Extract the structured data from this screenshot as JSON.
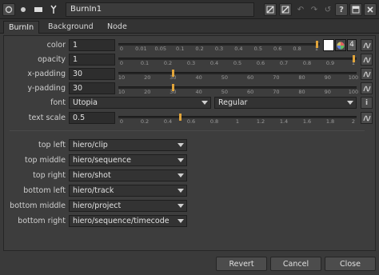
{
  "titlebar": {
    "node_name": "BurnIn1",
    "help_label": "?",
    "icons": [
      "node-settings-icon",
      "pin-icon",
      "tools-icon",
      "rect-a-icon",
      "rect-b-icon",
      "undo-icon",
      "redo-icon",
      "revert-icon",
      "help-icon",
      "float-icon",
      "close-icon"
    ]
  },
  "tabs": [
    "BurnIn",
    "Background",
    "Node"
  ],
  "active_tab": "BurnIn",
  "params": {
    "color": {
      "label": "color",
      "value": "1",
      "channels": "4",
      "ticks": [
        "0",
        "0.01",
        "0.05",
        "0.1",
        "0.2",
        "0.3",
        "0.4",
        "0.5",
        "0.6",
        "0.8",
        "1"
      ],
      "level": 1.0
    },
    "opacity": {
      "label": "opacity",
      "value": "1",
      "ticks": [
        "0",
        "0.1",
        "0.2",
        "0.3",
        "0.4",
        "0.5",
        "0.6",
        "0.7",
        "0.8",
        "0.9",
        "1"
      ],
      "level": 1.0
    },
    "x_padding": {
      "label": "x-padding",
      "value": "30",
      "ticks": [
        "10",
        "20",
        "30",
        "40",
        "50",
        "60",
        "70",
        "80",
        "90",
        "100"
      ],
      "level": 30
    },
    "y_padding": {
      "label": "y-padding",
      "value": "30",
      "ticks": [
        "10",
        "20",
        "30",
        "40",
        "50",
        "60",
        "70",
        "80",
        "90",
        "100"
      ],
      "level": 30
    },
    "font": {
      "label": "font",
      "family": "Utopia",
      "style": "Regular",
      "info": "i"
    },
    "text_scale": {
      "label": "text scale",
      "value": "0.5",
      "ticks": [
        "0",
        "0.2",
        "0.4",
        "0.6",
        "0.8",
        "1",
        "1.2",
        "1.4",
        "1.6",
        "1.8",
        "2"
      ],
      "level": 0.5
    }
  },
  "burnins": [
    {
      "label": "top left",
      "value": "hiero/clip"
    },
    {
      "label": "top middle",
      "value": "hiero/sequence"
    },
    {
      "label": "top right",
      "value": "hiero/shot"
    },
    {
      "label": "bottom left",
      "value": "hiero/track"
    },
    {
      "label": "bottom middle",
      "value": "hiero/project"
    },
    {
      "label": "bottom right",
      "value": "hiero/sequence/timecode"
    }
  ],
  "buttons": {
    "revert": "Revert",
    "cancel": "Cancel",
    "close": "Close"
  },
  "colors": {
    "accent": "#e0a43a",
    "background": "#3a3a3a"
  }
}
